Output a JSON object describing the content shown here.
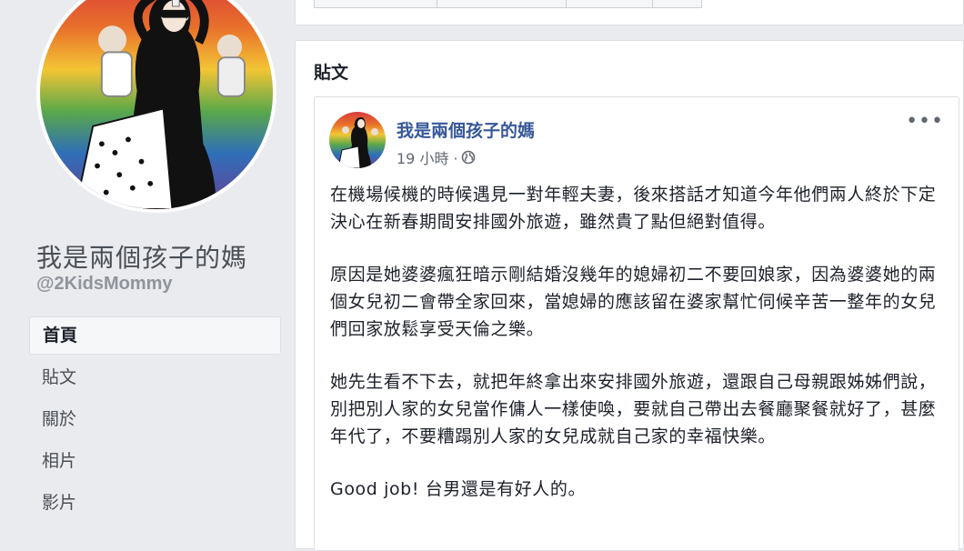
{
  "page": {
    "name": "我是兩個孩子的媽",
    "handle": "@2KidsMommy",
    "colors": {
      "link": "#365899",
      "background": "#e9ebee"
    }
  },
  "nav": {
    "items": [
      {
        "label": "首頁",
        "active": true
      },
      {
        "label": "貼文",
        "active": false
      },
      {
        "label": "關於",
        "active": false
      },
      {
        "label": "相片",
        "active": false
      },
      {
        "label": "影片",
        "active": false
      }
    ]
  },
  "posts": {
    "heading": "貼文",
    "post": {
      "author": "我是兩個孩子的媽",
      "time": "19 小時 ·",
      "privacy_icon": "globe-icon",
      "more_icon": "more-icon",
      "more_label": "•••",
      "paragraphs": [
        "在機場候機的時候遇見一對年輕夫妻，後來搭話才知道今年他們兩人終於下定決心在新春期間安排國外旅遊，雖然貴了點但絕對值得。",
        "原因是她婆婆瘋狂暗示剛結婚沒幾年的媳婦初二不要回娘家，因為婆婆她的兩個女兒初二會帶全家回來，當媳婦的應該留在婆家幫忙伺候辛苦一整年的女兒們回家放鬆享受天倫之樂。",
        "她先生看不下去，就把年終拿出來安排國外旅遊，還跟自己母親跟姊姊們說，別把別人家的女兒當作傭人一樣使喚，要就自己帶出去餐廳聚餐就好了，甚麼年代了，不要糟蹋別人家的女兒成就自己家的幸福快樂。",
        "Good job! 台男還是有好人的。"
      ]
    }
  }
}
